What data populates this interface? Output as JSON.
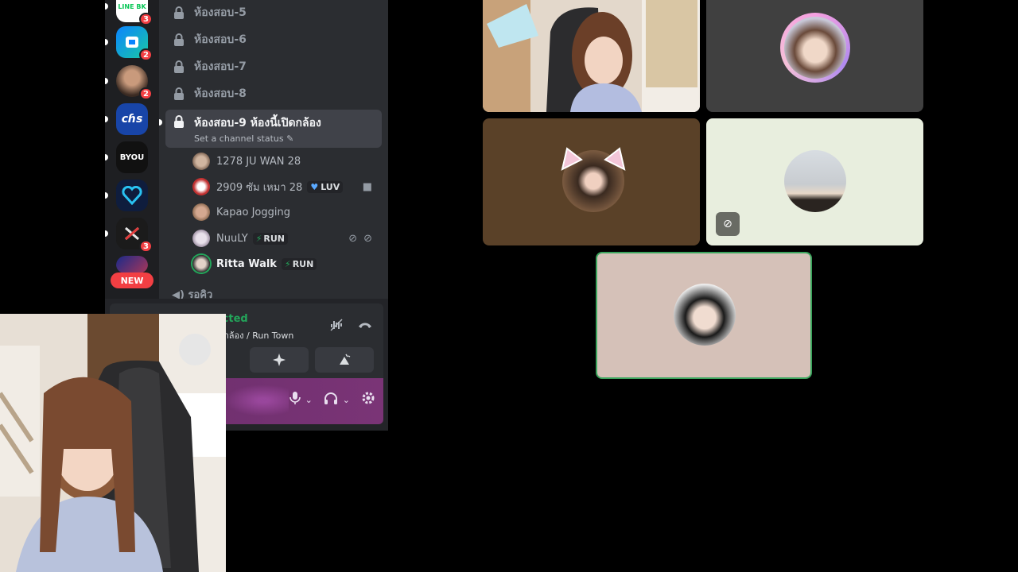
{
  "servers": [
    {
      "label": "LINE BK",
      "badge": "3",
      "color": "#ffffff"
    },
    {
      "label": "",
      "badge": "2",
      "color": "#0a84ff"
    },
    {
      "label": "",
      "badge": "2",
      "color": "#5a3b2c"
    },
    {
      "label": "cɦs",
      "badge": "",
      "color": "#1845a8"
    },
    {
      "label": "BYOU",
      "badge": "",
      "color": "#111111"
    },
    {
      "label": "",
      "badge": "",
      "color": "#1a3a7a"
    },
    {
      "label": "",
      "badge": "3",
      "color": "#222222"
    }
  ],
  "new_pill": "NEW",
  "channels": [
    {
      "name": "ห้องสอบ-5"
    },
    {
      "name": "ห้องสอบ-6"
    },
    {
      "name": "ห้องสอบ-7"
    },
    {
      "name": "ห้องสอบ-8"
    }
  ],
  "active_channel": {
    "name": "ห้องสอบ-9 ห้องนี้เปิดกล้อง",
    "status": "Set a channel status"
  },
  "members": [
    {
      "name": "1278 JU WAN 28",
      "tag": ""
    },
    {
      "name": "2909 ซัม เหมา 28",
      "tag": "LUV"
    },
    {
      "name": "Kapao Jogging",
      "tag": ""
    },
    {
      "name": "NuuLY",
      "tag": "RUN"
    },
    {
      "name": "Ritta Walk",
      "tag": "RUN"
    }
  ],
  "category_partial": "รอคิว",
  "voice": {
    "title": "Video Connected",
    "subtitle": "ดกล้อง / Run Town"
  },
  "icons": {
    "lock": "lock-icon",
    "camera": "video-camera-icon",
    "mute": "muted-mic-icon",
    "deafen": "deafened-icon",
    "noise": "noise-suppression-icon",
    "disconnect": "phone-hangup-icon",
    "activity": "activity-icon",
    "soundboard": "soundboard-icon",
    "mic": "mic-icon",
    "headphones": "headphones-icon",
    "settings": "gear-icon",
    "camera_off": "camera-off-icon"
  },
  "colors": {
    "speaking": "#3ba55d",
    "badge": "#f23f43",
    "connected": "#23a55a"
  }
}
